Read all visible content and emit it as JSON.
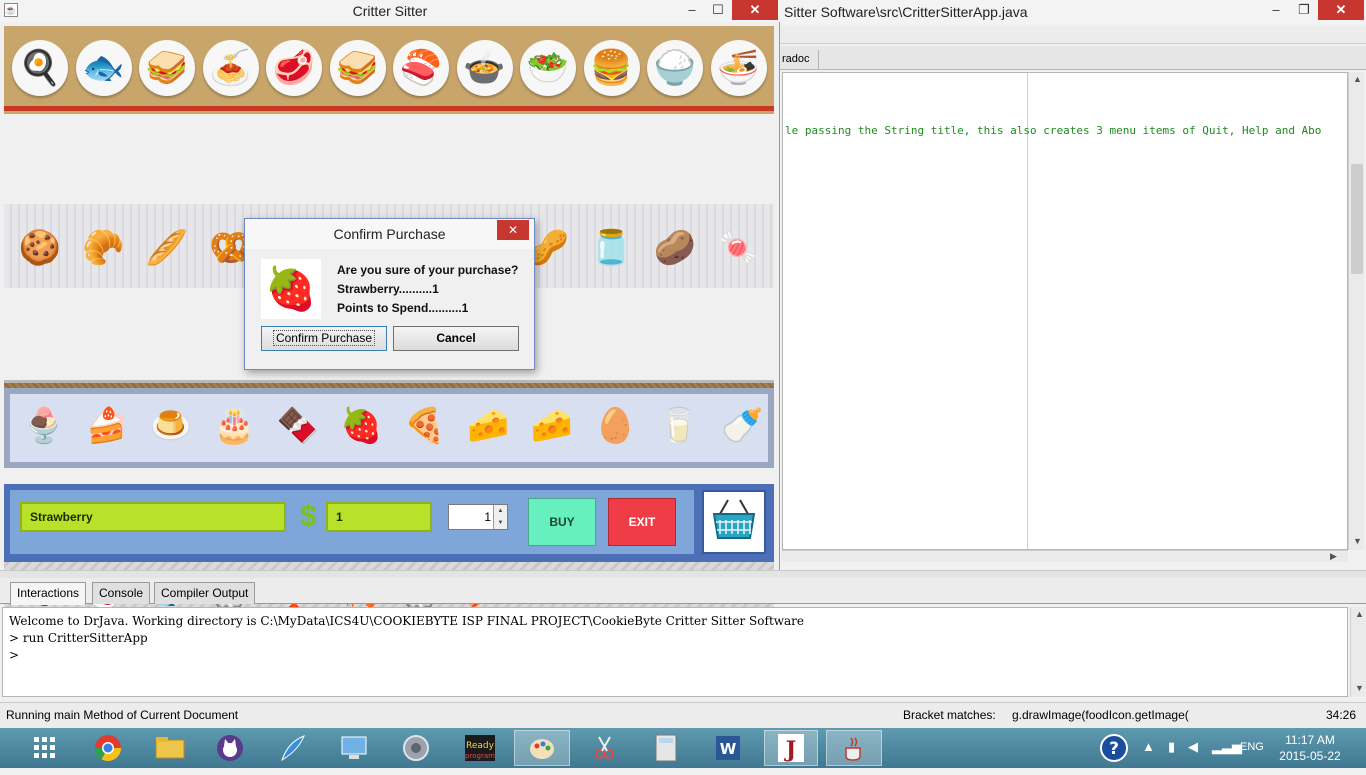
{
  "editor": {
    "title": "Sitter Software\\src\\CritterSitterApp.java",
    "tab_label": "radoc",
    "code_line": "le passing the String title, this also creates 3 menu items of Quit, Help and Abo",
    "window_buttons": {
      "minimize": "‒",
      "maximize": "❐",
      "close": "✕"
    }
  },
  "critter_window": {
    "title": "Critter Sitter",
    "window_buttons": {
      "minimize": "‒",
      "maximize": "☐",
      "close": "✕"
    },
    "shelves": {
      "meals": [
        "🍳",
        "🐟",
        "🥪",
        "🍝",
        "🥩",
        "🥪",
        "🍣",
        "🍲",
        "🥗",
        "🍔",
        "🍚",
        "🍜"
      ],
      "snacks": [
        "🍪",
        "🥐",
        "🥖",
        "🥨",
        "🍞",
        "🍫",
        "🍩",
        "🍥",
        "🥜",
        "🫙",
        "🥔",
        "🍬"
      ],
      "produce": [
        "🍎",
        "🍌",
        "🍇",
        "🥭",
        "🥬",
        "🥔",
        "🍅",
        "🌽"
      ],
      "seafood": [
        "🐟",
        "🍣",
        "🐟",
        "🦪",
        "🦞",
        "🦐",
        "🦪",
        "🥓"
      ],
      "dairy": [
        "🍨",
        "🍰",
        "🍮",
        "🎂",
        "🍫",
        "🍓",
        "🍕",
        "🧀",
        "🧀",
        "🥚",
        "🥛",
        "🍼"
      ]
    },
    "controls": {
      "item_name": "Strawberry",
      "currency_symbol": "$",
      "cost": "1",
      "quantity": "1",
      "buy_label": "BUY",
      "exit_label": "EXIT"
    }
  },
  "dialog": {
    "title": "Confirm Purchase",
    "close_glyph": "✕",
    "image_icon": "🍓",
    "question": "Are you sure of your purchase?",
    "item_line": "Strawberry..........1",
    "points_line": "Points to Spend..........1",
    "confirm_label": "Confirm Purchase",
    "cancel_label": "Cancel"
  },
  "bottom_tabs": [
    "Interactions",
    "Console",
    "Compiler Output"
  ],
  "interactions": {
    "lines": [
      "Welcome to DrJava.  Working directory is C:\\MyData\\ICS4U\\COOKIEBYTE ISP FINAL PROJECT\\CookieByte Critter Sitter Software",
      "> run CritterSitterApp",
      ">"
    ]
  },
  "status_bar": {
    "message": "Running main Method of Current Document",
    "bracket_label": "Bracket matches:",
    "bracket_value": "g.drawImage(foodIcon.getImage(",
    "position": "34:26"
  },
  "taskbar": {
    "lang": "ENG",
    "time": "11:17 AM",
    "date": "2015-05-22"
  }
}
